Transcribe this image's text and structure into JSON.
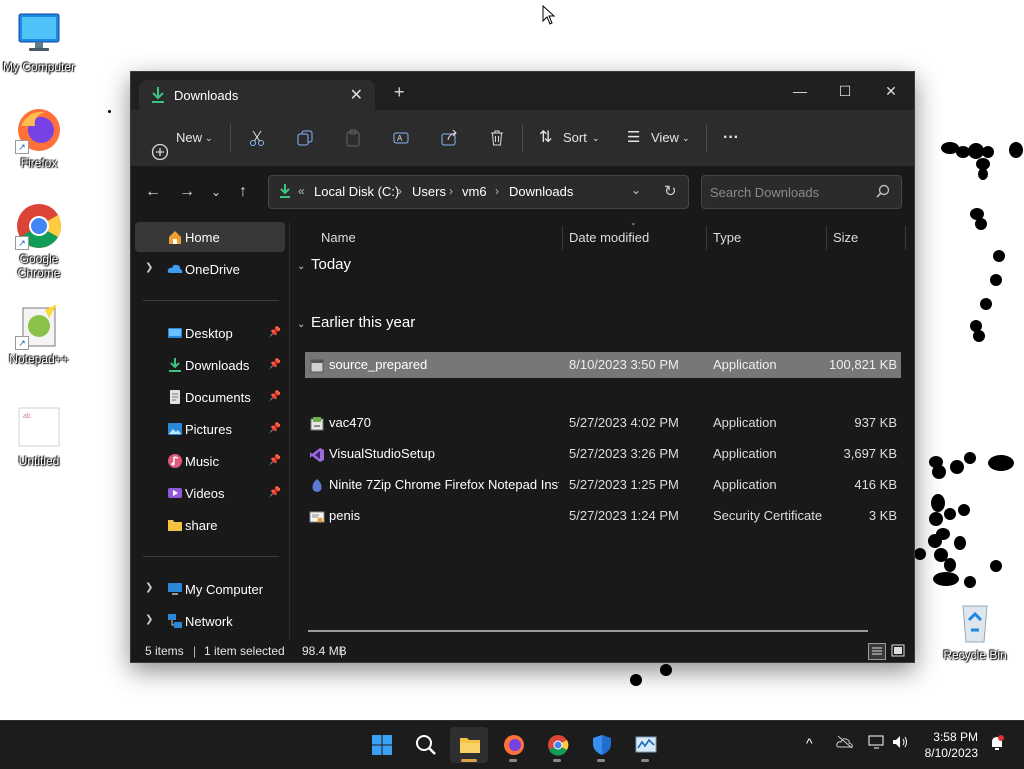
{
  "desktop": {
    "icons": [
      {
        "label": "My Computer",
        "icon": "monitor-icon"
      },
      {
        "label": "Firefox",
        "icon": "firefox-icon"
      },
      {
        "label": "Google Chrome",
        "icon": "chrome-icon"
      },
      {
        "label": "Notepad++",
        "icon": "notepadpp-icon"
      },
      {
        "label": "Untitled",
        "icon": "document-icon"
      },
      {
        "label": "Recycle Bin",
        "icon": "recycle-bin-icon"
      }
    ]
  },
  "window": {
    "tab_title": "Downloads",
    "new_tab": "+",
    "controls": {
      "minimize": "—",
      "maximize": "☐",
      "close": "✕"
    },
    "toolbar": {
      "new_label": "New",
      "sort_label": "Sort",
      "view_label": "View",
      "more_label": "···"
    },
    "address": {
      "overflow": "«",
      "crumbs": [
        "Local Disk (C:)",
        "Users",
        "vm6",
        "Downloads"
      ],
      "separator": "›"
    },
    "search": {
      "placeholder": "Search Downloads"
    },
    "nav": {
      "home": "Home",
      "onedrive": "OneDrive",
      "quick": [
        "Desktop",
        "Downloads",
        "Documents",
        "Pictures",
        "Music",
        "Videos",
        "share"
      ],
      "my_computer": "My Computer",
      "network": "Network"
    },
    "columns": {
      "name": "Name",
      "date": "Date modified",
      "type": "Type",
      "size": "Size"
    },
    "groups": {
      "today": "Today",
      "earlier": "Earlier this year"
    },
    "files_today": [
      {
        "name": "source_prepared",
        "date": "8/10/2023 3:50 PM",
        "type": "Application",
        "size": "100,821 KB",
        "selected": true
      }
    ],
    "files_earlier": [
      {
        "name": "vac470",
        "date": "5/27/2023 4:02 PM",
        "type": "Application",
        "size": "937 KB"
      },
      {
        "name": "VisualStudioSetup",
        "date": "5/27/2023 3:26 PM",
        "type": "Application",
        "size": "3,697 KB"
      },
      {
        "name": "Ninite 7Zip Chrome Firefox Notepad Inst...",
        "date": "5/27/2023 1:25 PM",
        "type": "Application",
        "size": "416 KB"
      },
      {
        "name": "penis",
        "date": "5/27/2023 1:24 PM",
        "type": "Security Certificate",
        "size": "3 KB"
      }
    ],
    "status": {
      "items": "5 items",
      "selected": "1 item selected",
      "size": "98.4 MB",
      "sep": "|"
    }
  },
  "taskbar": {
    "time": "3:58 PM",
    "date": "8/10/2023",
    "tray_chevron": "^"
  },
  "colors": {
    "window_bg": "#191919",
    "toolbar_bg": "#2c2c2c",
    "selected_row": "#777777",
    "taskbar_bg": "#1c1c1c"
  }
}
